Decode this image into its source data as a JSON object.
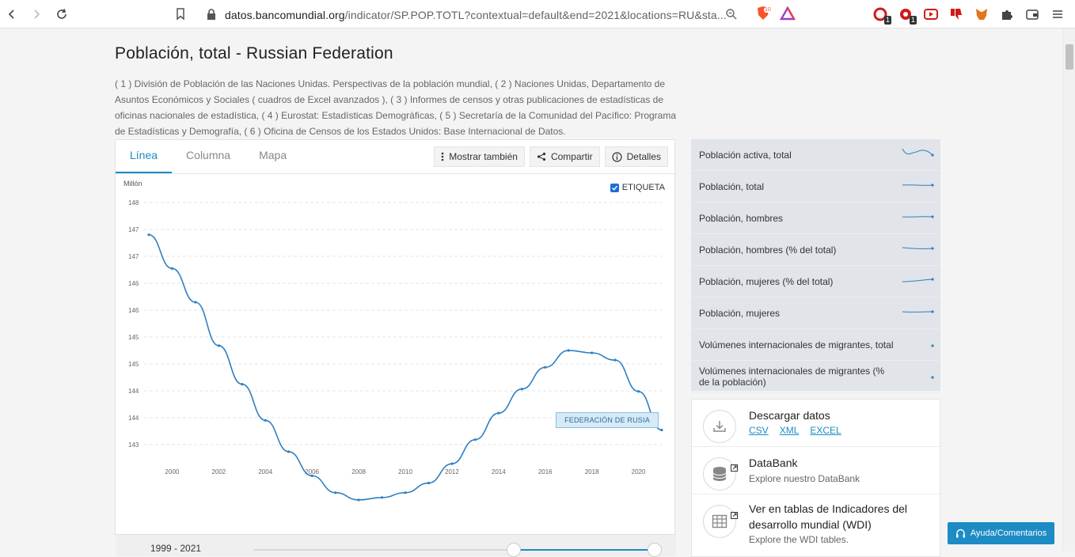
{
  "browser": {
    "url_host": "datos.bancomundial.org",
    "url_path": "/indicator/SP.POP.TOTL?contextual=default&end=2021&locations=RU&sta...",
    "shield_count": "10",
    "ext_badge_1": "1",
    "ext_badge_2": "1"
  },
  "page": {
    "title": "Población, total - Russian Federation",
    "sources": "( 1 ) División de Población de las Naciones Unidas. Perspectivas de la población mundial, ( 2 ) Naciones Unidas, Departamento de Asuntos Económicos y Sociales ( cuadros de Excel avanzados ), ( 3 ) Informes de censos y otras publicaciones de estadísticas de oficinas nacionales de estadística, ( 4 ) Eurostat: Estadísticas Demográficas, ( 5 ) Secretaría de la Comunidad del Pacífico: Programa de Estadísticas y Demografía, ( 6 ) Oficina de Censos de los Estados Unidos: Base Internacional de Datos."
  },
  "tabs": [
    {
      "label": "Línea"
    },
    {
      "label": "Columna"
    },
    {
      "label": "Mapa"
    }
  ],
  "actions": {
    "mostrar": "Mostrar también",
    "compartir": "Compartir",
    "detalles": "Detalles"
  },
  "chart": {
    "checkbox_label": "ETIQUETA",
    "unit": "Millón",
    "series_label": "FEDERACIÓN DE RUSIA",
    "range_label": "1999 - 2021"
  },
  "chart_data": {
    "type": "line",
    "ylabel": "Millón",
    "ytick_labels": [
      "148",
      "147",
      "147",
      "146",
      "146",
      "145",
      "145",
      "144",
      "144",
      "143"
    ],
    "xticks": [
      2000,
      2002,
      2004,
      2006,
      2008,
      2010,
      2012,
      2014,
      2016,
      2018,
      2020
    ],
    "xlim": [
      1999,
      2021
    ],
    "ylim": [
      142.75,
      148.1
    ],
    "series": [
      {
        "name": "FEDERACIÓN DE RUSIA",
        "x": [
          1999,
          2000,
          2001,
          2002,
          2003,
          2004,
          2005,
          2006,
          2007,
          2008,
          2009,
          2010,
          2011,
          2012,
          2013,
          2014,
          2015,
          2016,
          2017,
          2018,
          2019,
          2020,
          2021
        ],
        "y": [
          147.35,
          146.65,
          145.95,
          145.05,
          144.25,
          143.5,
          142.85,
          142.35,
          142.0,
          141.85,
          141.9,
          142.0,
          142.2,
          142.6,
          143.1,
          143.65,
          144.15,
          144.6,
          144.95,
          144.9,
          144.75,
          144.1,
          143.3
        ],
        "color": "#2f7fc1"
      }
    ]
  },
  "related": [
    {
      "label": "Población activa, total"
    },
    {
      "label": "Población, total"
    },
    {
      "label": "Población, hombres"
    },
    {
      "label": "Población, hombres (% del total)"
    },
    {
      "label": "Población, mujeres (% del total)"
    },
    {
      "label": "Población, mujeres"
    },
    {
      "label": "Volúmenes internacionales de migrantes, total"
    },
    {
      "label": "Volúmenes internacionales de migrantes (% de la población)"
    }
  ],
  "downloads": {
    "title": "Descargar datos",
    "csv": "CSV",
    "xml": "XML",
    "excel": "EXCEL",
    "databank_title": "DataBank",
    "databank_sub": "Explore nuestro DataBank",
    "wdi_title": "Ver en tablas de Indicadores del desarrollo mundial (WDI)",
    "wdi_sub": "Explore the WDI tables."
  },
  "help": {
    "label": "Ayuda/Comentarios"
  },
  "colors": {
    "accent": "#1d8bc4",
    "line": "#2f7fc1"
  }
}
